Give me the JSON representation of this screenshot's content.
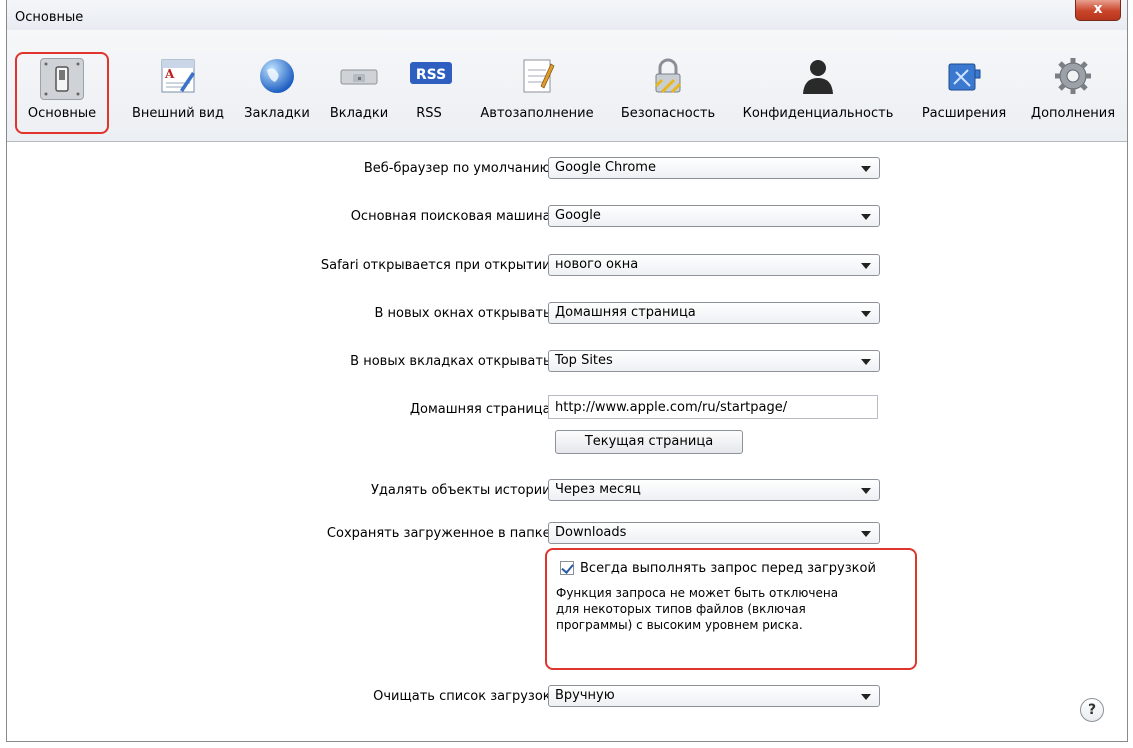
{
  "window": {
    "title": "Основные",
    "close_glyph": "x"
  },
  "toolbar": {
    "items": [
      {
        "label": "Основные",
        "icon": "general-switch-icon",
        "selected": true
      },
      {
        "label": "Внешний вид",
        "icon": "appearance-icon"
      },
      {
        "label": "Закладки",
        "icon": "bookmarks-globe-icon"
      },
      {
        "label": "Вкладки",
        "icon": "tabs-icon"
      },
      {
        "label": "RSS",
        "icon": "rss-icon",
        "badge": "RSS"
      },
      {
        "label": "Автозаполнение",
        "icon": "autofill-icon"
      },
      {
        "label": "Безопасность",
        "icon": "security-lock-icon"
      },
      {
        "label": "Конфиденциальность",
        "icon": "privacy-person-icon"
      },
      {
        "label": "Расширения",
        "icon": "extensions-icon"
      },
      {
        "label": "Дополнения",
        "icon": "advanced-gear-icon"
      }
    ]
  },
  "form": {
    "default_browser": {
      "label": "Веб-браузер по умолчанию:",
      "value": "Google Chrome"
    },
    "search_engine": {
      "label": "Основная поисковая машина:",
      "value": "Google"
    },
    "safari_opens": {
      "label": "Safari открывается при открытии:",
      "value": "нового окна"
    },
    "new_windows": {
      "label": "В новых окнах открывать:",
      "value": "Домашняя страница"
    },
    "new_tabs": {
      "label": "В новых вкладках открывать:",
      "value": "Top Sites"
    },
    "homepage": {
      "label": "Домашняя страница:",
      "value": "http://www.apple.com/ru/startpage/"
    },
    "current_page_button": "Текущая страница",
    "remove_history": {
      "label": "Удалять объекты истории:",
      "value": "Через месяц"
    },
    "save_downloads": {
      "label": "Сохранять загруженное в папке:",
      "value": "Downloads"
    },
    "ask_before_download": {
      "label": "Всегда выполнять запрос перед загрузкой",
      "checked": true,
      "note_line1": "Функция запроса не может быть отключена",
      "note_line2": "для некоторых типов файлов (включая",
      "note_line3": "программы) с высоким уровнем риска."
    },
    "clear_downloads": {
      "label": "Очищать список загрузок:",
      "value": "Вручную"
    }
  },
  "help_glyph": "?",
  "colors": {
    "highlight": "#e0352d",
    "accent": "#2a5aa8"
  }
}
